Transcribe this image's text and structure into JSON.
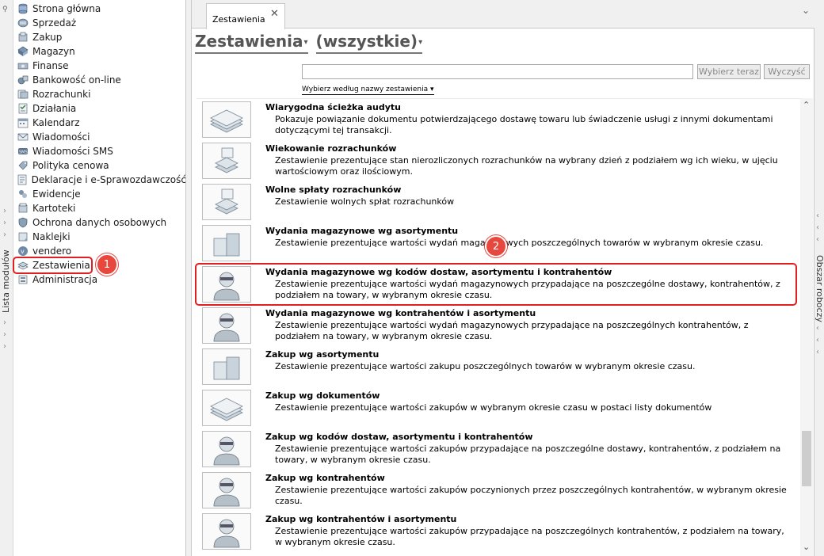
{
  "left_strip": {
    "label": "Lista modułów"
  },
  "modules": [
    {
      "label": "Strona główna",
      "icon": "home-db-icon"
    },
    {
      "label": "Sprzedaż",
      "icon": "sales-icon"
    },
    {
      "label": "Zakup",
      "icon": "purchase-icon"
    },
    {
      "label": "Magazyn",
      "icon": "warehouse-icon"
    },
    {
      "label": "Finanse",
      "icon": "finance-icon"
    },
    {
      "label": "Bankowość on-line",
      "icon": "bank-icon"
    },
    {
      "label": "Rozrachunki",
      "icon": "settlements-icon"
    },
    {
      "label": "Działania",
      "icon": "actions-icon"
    },
    {
      "label": "Kalendarz",
      "icon": "calendar-icon"
    },
    {
      "label": "Wiadomości",
      "icon": "messages-icon"
    },
    {
      "label": "Wiadomości SMS",
      "icon": "sms-icon"
    },
    {
      "label": "Polityka cenowa",
      "icon": "pricing-icon"
    },
    {
      "label": "Deklaracje i e-Sprawozdawczość",
      "icon": "declarations-icon"
    },
    {
      "label": "Ewidencje",
      "icon": "records-icon"
    },
    {
      "label": "Kartoteki",
      "icon": "cards-icon"
    },
    {
      "label": "Ochrona danych osobowych",
      "icon": "data-protection-icon"
    },
    {
      "label": "Naklejki",
      "icon": "stickers-icon"
    },
    {
      "label": "vendero",
      "icon": "vendero-icon"
    },
    {
      "label": "Zestawienia",
      "icon": "reports-icon"
    },
    {
      "label": "Administracja",
      "icon": "admin-icon"
    }
  ],
  "tab": {
    "label": "Zestawienia",
    "close": "✕"
  },
  "heading": {
    "title": "Zestawienia",
    "filter": "(wszystkie)",
    "caret": "▾"
  },
  "search": {
    "value": "",
    "choose_button": "Wybierz teraz",
    "clear_button": "Wyczyść",
    "filter_link": "Wybierz według nazwy zestawienia ▾"
  },
  "reports": [
    {
      "title": "Wiarygodna ścieżka audytu",
      "desc": "Pokazuje powiązanie dokumentu potwierdzającego dostawę towaru lub świadczenie usługi z innymi dokumentami dotyczącymi tej transakcji.",
      "icon": "paper-stack-icon"
    },
    {
      "title": "Wiekowanie rozrachunków",
      "desc": "Zestawienie prezentujące stan nierozliczonych rozrachunków na wybrany dzień z podziałem wg ich wieku, w ujęciu wartościowym oraz ilościowym.",
      "icon": "printer-stack-icon"
    },
    {
      "title": "Wolne spłaty rozrachunków",
      "desc": "Zestawienie wolnych spłat rozrachunków",
      "icon": "printer-stack-icon"
    },
    {
      "title": "Wydania magazynowe wg asortymentu",
      "desc": "Zestawienie prezentujące wartości wydań magazynowych poszczególnych towarów w wybranym okresie czasu.",
      "icon": "boxes-icon"
    },
    {
      "title": "Wydania magazynowe wg kodów dostaw, asortymentu i kontrahentów",
      "desc": "Zestawienie prezentujące wartości wydań magazynowych przypadające na poszczególne dostawy, kontrahentów, z podziałem na towary, w wybranym okresie czasu.",
      "icon": "person-icon"
    },
    {
      "title": "Wydania magazynowe wg kontrahentów i asortymentu",
      "desc": "Zestawienie prezentujące wartości wydań magazynowych przypadające na poszczególnych kontrahentów, z podziałem na towary, w wybranym okresie czasu.",
      "icon": "person-icon"
    },
    {
      "title": "Zakup wg asortymentu",
      "desc": "Zestawienie prezentujące wartości zakupu poszczególnych towarów w wybranym okresie czasu.",
      "icon": "boxes-icon"
    },
    {
      "title": "Zakup wg dokumentów",
      "desc": "Zestawienie prezentujące wartości zakupów w wybranym okresie czasu w postaci listy dokumentów",
      "icon": "paper-stack-icon"
    },
    {
      "title": "Zakup wg kodów dostaw, asortymentu i kontrahentów",
      "desc": "Zestawienie prezentujące wartości zakupów przypadające na poszczególne dostawy, kontrahentów, z podziałem na towary, w wybranym okresie czasu.",
      "icon": "person-icon"
    },
    {
      "title": "Zakup wg kontrahentów",
      "desc": "Zestawienie prezentujące wartości zakupów poczynionych przez poszczególnych kontrahentów, w wybranym okresie czasu.",
      "icon": "person-icon"
    },
    {
      "title": "Zakup wg kontrahentów i asortymentu",
      "desc": "Zestawienie prezentujące wartości zakupów przypadające na poszczególnych kontrahentów, z podziałem na towary, w wybranym okresie czasu.",
      "icon": "person-icon"
    }
  ],
  "right_strip": {
    "label": "Obszar roboczy"
  },
  "annotations": {
    "badge1": "1",
    "badge2": "2",
    "highlight_color": "#e02020"
  }
}
